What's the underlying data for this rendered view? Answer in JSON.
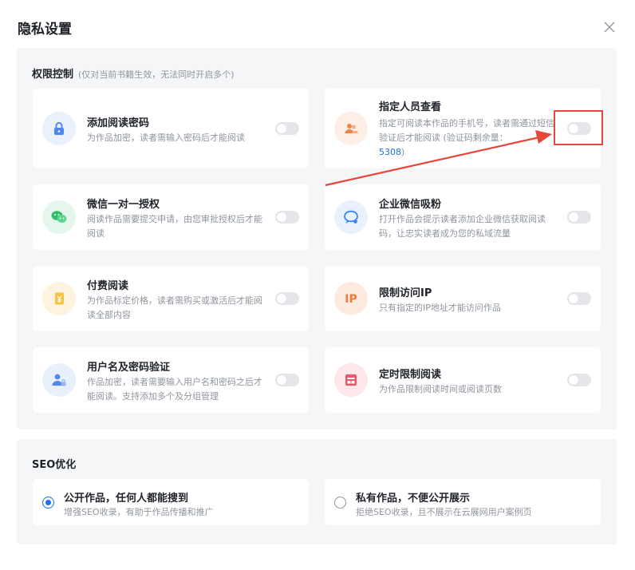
{
  "dialog": {
    "title": "隐私设置"
  },
  "permissions": {
    "heading": "权限控制",
    "hint": "(仅对当前书籍生效，无法同时开启多个)",
    "items": [
      {
        "title": "添加阅读密码",
        "desc": "为作品加密，读者需输入密码后才能阅读",
        "icon": "lock-icon",
        "enabled": false
      },
      {
        "title": "指定人员查看",
        "desc": "指定可阅读本作品的手机号，读者需通过短信验证后才能阅读 (验证码剩余量：",
        "desc_link": "5308",
        "desc_tail": ")",
        "icon": "people-icon",
        "enabled": false
      },
      {
        "title": "微信一对一授权",
        "desc": "阅读作品需要提交申请，由您审批授权后才能阅读",
        "icon": "wechat-icon",
        "enabled": false
      },
      {
        "title": "企业微信吸粉",
        "desc": "打开作品会提示读者添加企业微信获取阅读码，让忠实读者成为您的私域流量",
        "icon": "chat-bubble-icon",
        "enabled": false
      },
      {
        "title": "付费阅读",
        "desc": "为作品标定价格，读者需购买或激活后才能阅读全部内容",
        "icon": "yen-coin-icon",
        "enabled": false
      },
      {
        "title": "限制访问IP",
        "desc": "只有指定的IP地址才能访问作品",
        "icon": "ip-icon",
        "enabled": false
      },
      {
        "title": "用户名及密码验证",
        "desc": "作品加密，读者需要输入用户名和密码之后才能阅读。支持添加多个及分组管理",
        "icon": "user-lock-icon",
        "enabled": false
      },
      {
        "title": "定时限制阅读",
        "desc": "为作品限制阅读时间或阅读页数",
        "icon": "calendar-icon",
        "enabled": false
      }
    ]
  },
  "seo": {
    "heading": "SEO优化",
    "options": [
      {
        "title": "公开作品，任何人都能搜到",
        "desc": "增强SEO收录，有助于作品传播和推广",
        "selected": true
      },
      {
        "title": "私有作品，不便公开展示",
        "desc": "拒绝SEO收录，且不展示在云展网用户案例页",
        "selected": false
      }
    ]
  },
  "colors": {
    "accent": "#1a73e8",
    "annotation": "#e8463a",
    "section_bg": "#f5f6f8",
    "toggle_off": "#e4e6ea"
  }
}
